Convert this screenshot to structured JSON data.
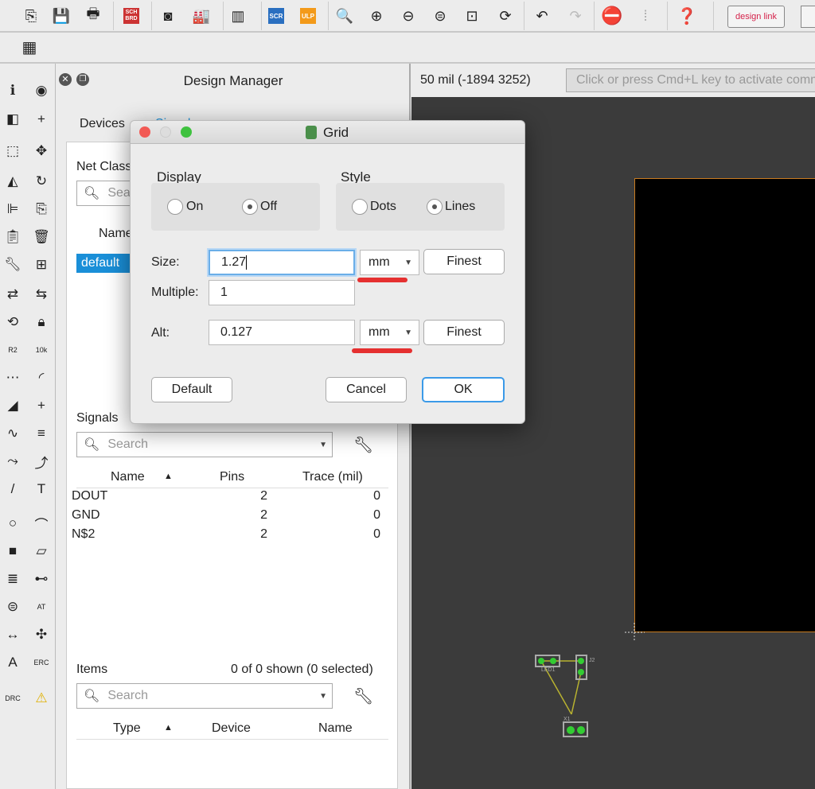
{
  "toolbar": {
    "top_icons": [
      "open-icon",
      "save-icon",
      "print-icon",
      "sch-brd-switch-icon",
      "cam-icon",
      "manufacturing-icon",
      "library-icon",
      "script-icon",
      "ulp-icon",
      "zoom-fit-icon",
      "zoom-in-icon",
      "zoom-out-icon",
      "zoom-redraw-icon",
      "zoom-select-icon",
      "refresh-icon",
      "undo-icon",
      "redo-icon",
      "stop-icon",
      "go-icon",
      "help-icon"
    ],
    "sch_brd": "SCH BRD",
    "scr": "SCR",
    "ulp": "ULP",
    "design_link": "design link",
    "grid_icon": "grid-icon"
  },
  "left_tools": [
    "info-icon",
    "show-icon",
    "layer-icon",
    "mark-icon",
    "group-icon",
    "move-icon",
    "mirror-icon",
    "rotate-icon",
    "align-icon",
    "copy-icon",
    "paste-icon",
    "delete-icon",
    "change-icon",
    "add-icon",
    "replace-icon",
    "swap-icon",
    "optimize-icon",
    "lock-icon",
    "name-icon",
    "value-icon",
    "smash-icon",
    "miter-icon",
    "split-icon",
    "via-icon",
    "meander-icon",
    "signal-icon",
    "route-icon",
    "ripup-icon",
    "line-icon",
    "text-icon",
    "circle-icon",
    "arc-icon",
    "rect-icon",
    "polygon-icon",
    "via2-icon",
    "signal2-icon",
    "hole-icon",
    "attribute-icon",
    "dimension-icon",
    "ratsnest-icon",
    "autorouter-icon",
    "erc-icon",
    "drc-icon",
    "warning-icon"
  ],
  "design_manager": {
    "title": "Design Manager",
    "tabs": [
      "Devices",
      "Signals"
    ],
    "net_classes_label": "Net Classes",
    "search_placeholder": "Search",
    "name_header": "Name",
    "net_class_selected": "default",
    "signals": {
      "label": "Signals",
      "search_placeholder": "Search",
      "headers": [
        "Name",
        "Pins",
        "Trace (mil)"
      ],
      "rows": [
        {
          "name": "DOUT",
          "pins": "2",
          "trace": "0"
        },
        {
          "name": "GND",
          "pins": "2",
          "trace": "0"
        },
        {
          "name": "N$2",
          "pins": "2",
          "trace": "0"
        }
      ]
    },
    "items": {
      "label": "Items",
      "count": "0 of 0 shown (0 selected)",
      "search_placeholder": "Search",
      "headers": [
        "Type",
        "Device",
        "Name"
      ]
    }
  },
  "status": {
    "coords": "50 mil (-1894 3252)",
    "command_placeholder": "Click or press Cmd+L key to activate command line"
  },
  "canvas": {
    "parts": [
      "LED1",
      "J2",
      "X1"
    ]
  },
  "dialog": {
    "title": "Grid",
    "display": {
      "label": "Display",
      "on": "On",
      "off": "Off",
      "selected": "Off"
    },
    "style": {
      "label": "Style",
      "dots": "Dots",
      "lines": "Lines",
      "selected": "Lines"
    },
    "size": {
      "label": "Size:",
      "value": "1.27",
      "unit": "mm",
      "finest": "Finest"
    },
    "multiple": {
      "label": "Multiple:",
      "value": "1"
    },
    "alt": {
      "label": "Alt:",
      "value": "0.127",
      "unit": "mm",
      "finest": "Finest"
    },
    "buttons": {
      "default": "Default",
      "cancel": "Cancel",
      "ok": "OK"
    }
  },
  "colors": {
    "accent": "#1a8fd8",
    "annotation": "#e53030",
    "board_outline": "#c87a1e",
    "canvas": "#3b3b3b"
  }
}
